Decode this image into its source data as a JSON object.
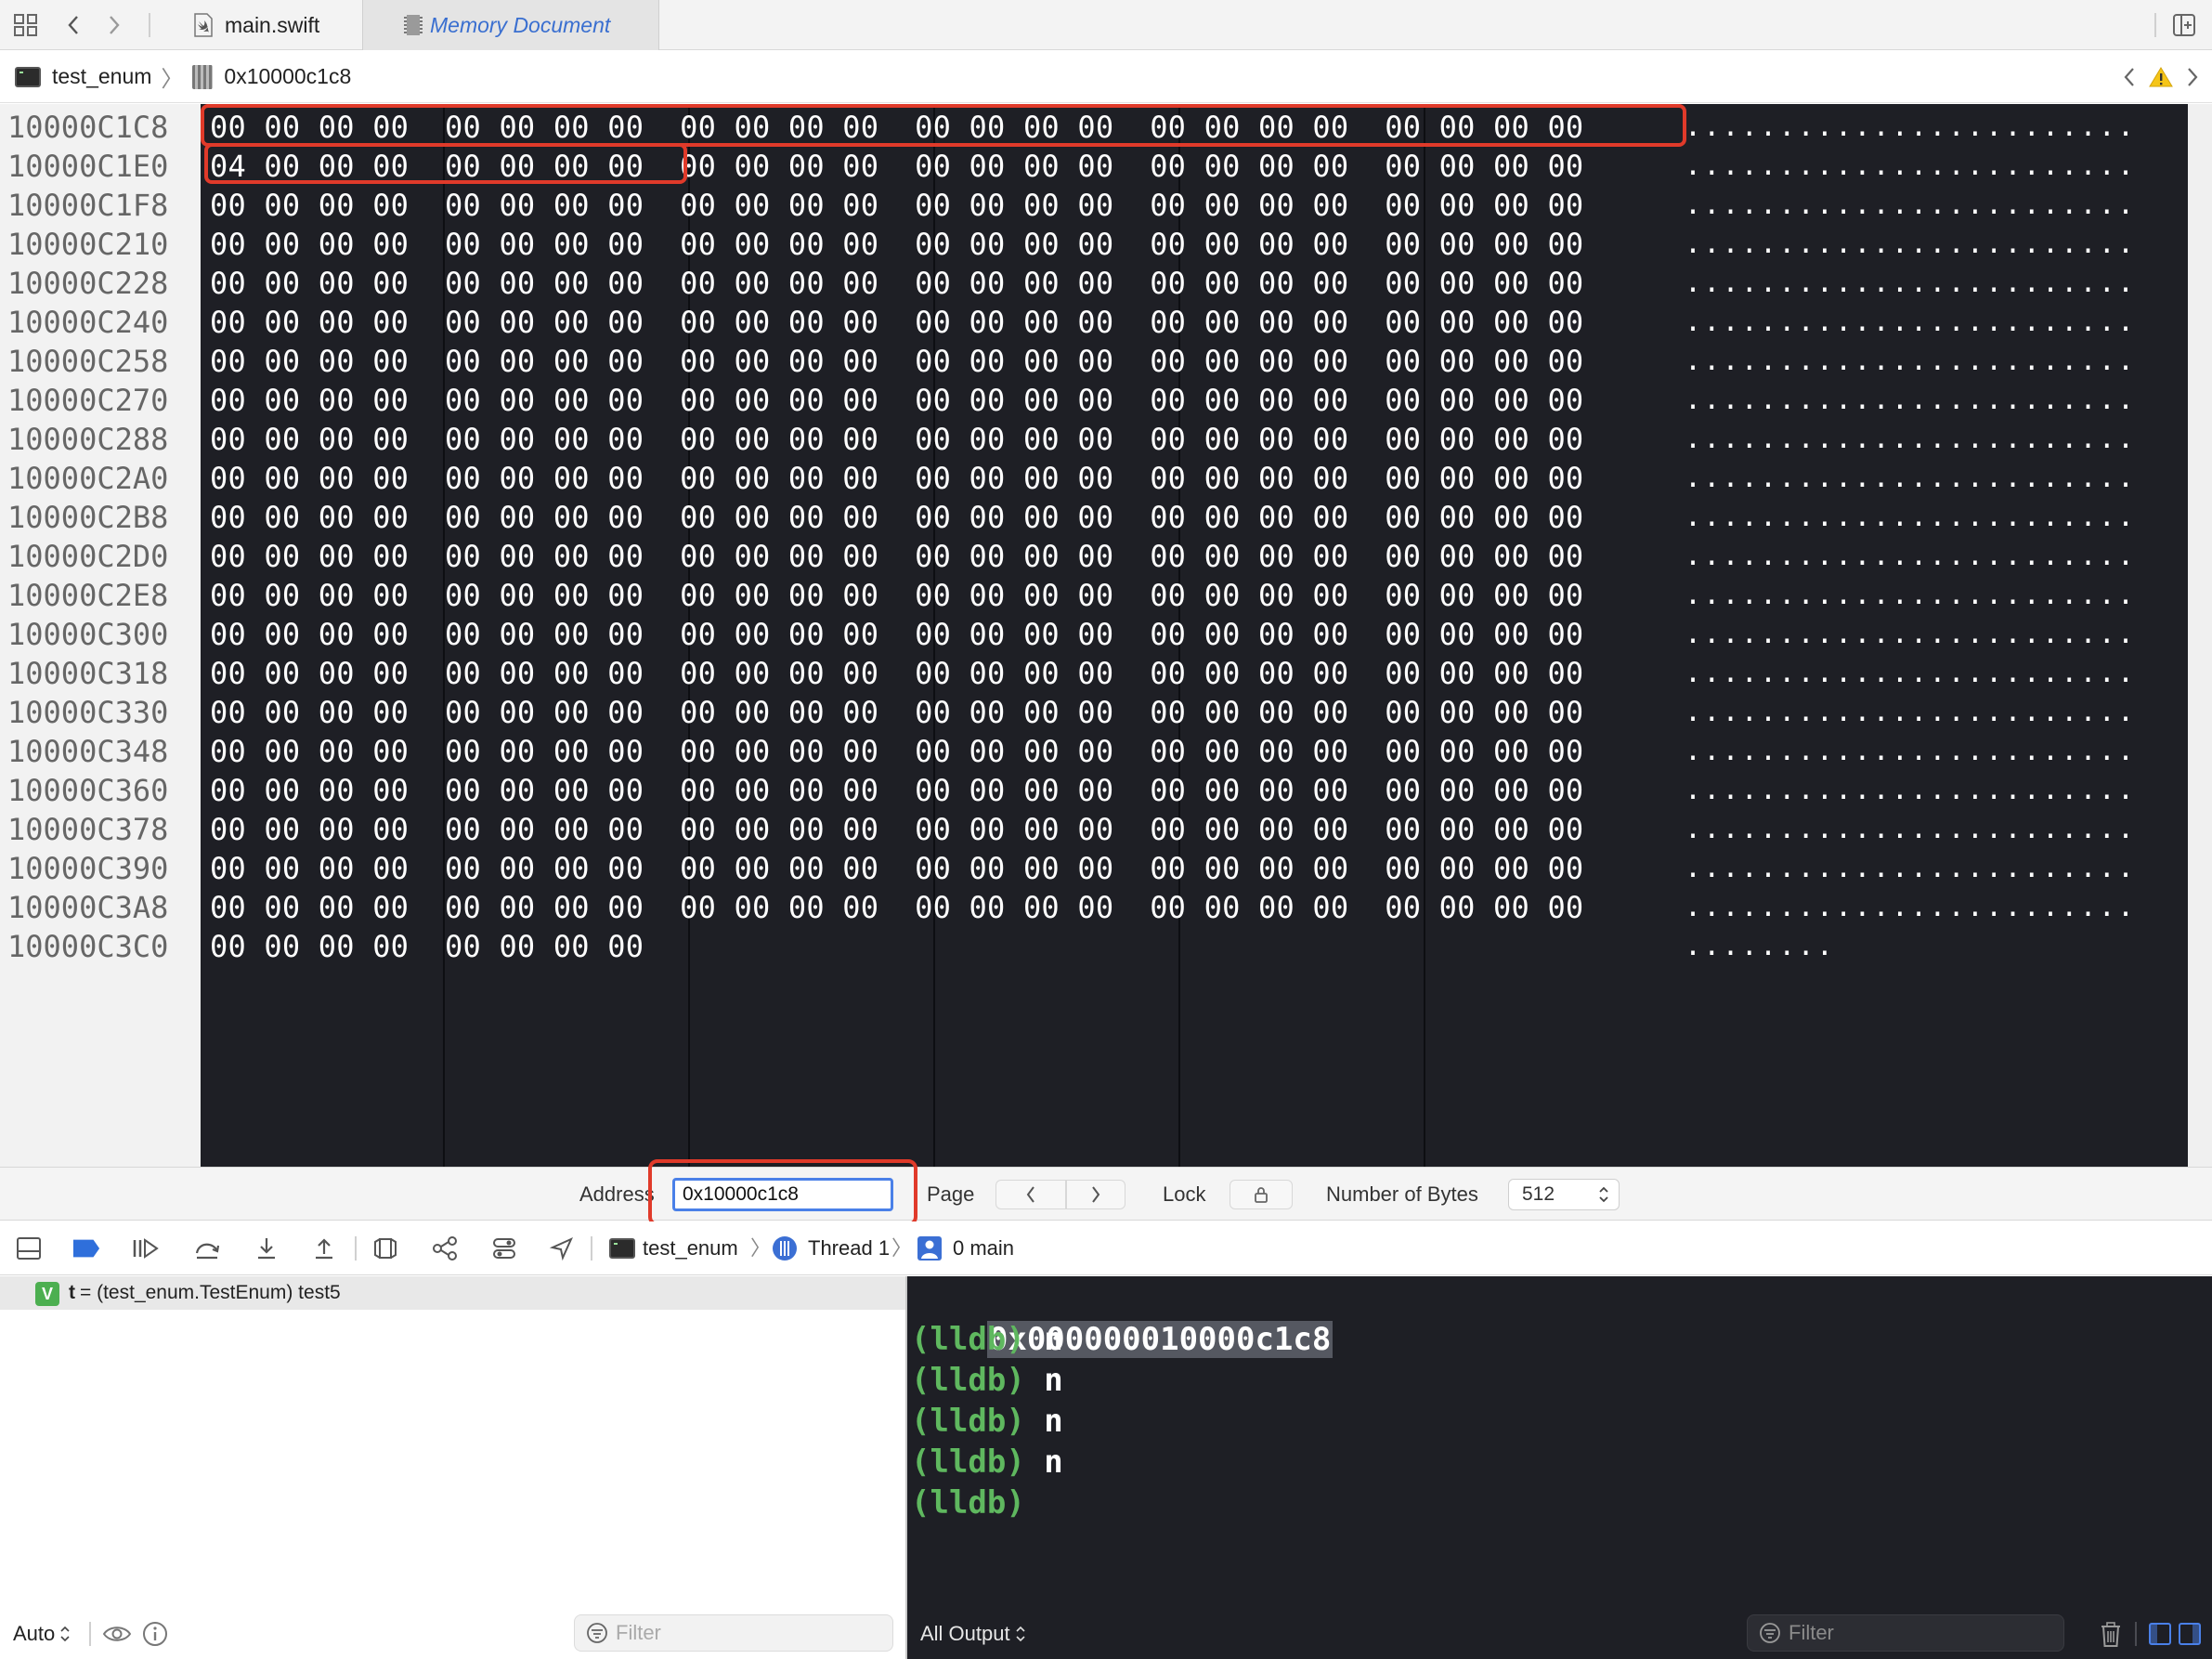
{
  "tabs": [
    {
      "label": "main.swift",
      "icon": "swift-file-icon",
      "active": false
    },
    {
      "label": "Memory Document",
      "icon": "memory-chip-icon",
      "active": true
    }
  ],
  "jumpbar": {
    "target": "test_enum",
    "address": "0x10000c1c8"
  },
  "memory": {
    "rows": [
      {
        "addr": "10000C1C8",
        "hex": "00 00 00 00  00 00 00 00  00 00 00 00  00 00 00 00  00 00 00 00  00 00 00 00",
        "ascii": "........................"
      },
      {
        "addr": "10000C1E0",
        "hex": "04 00 00 00  00 00 00 00  00 00 00 00  00 00 00 00  00 00 00 00  00 00 00 00",
        "ascii": "........................"
      },
      {
        "addr": "10000C1F8",
        "hex": "00 00 00 00  00 00 00 00  00 00 00 00  00 00 00 00  00 00 00 00  00 00 00 00",
        "ascii": "........................"
      },
      {
        "addr": "10000C210",
        "hex": "00 00 00 00  00 00 00 00  00 00 00 00  00 00 00 00  00 00 00 00  00 00 00 00",
        "ascii": "........................"
      },
      {
        "addr": "10000C228",
        "hex": "00 00 00 00  00 00 00 00  00 00 00 00  00 00 00 00  00 00 00 00  00 00 00 00",
        "ascii": "........................"
      },
      {
        "addr": "10000C240",
        "hex": "00 00 00 00  00 00 00 00  00 00 00 00  00 00 00 00  00 00 00 00  00 00 00 00",
        "ascii": "........................"
      },
      {
        "addr": "10000C258",
        "hex": "00 00 00 00  00 00 00 00  00 00 00 00  00 00 00 00  00 00 00 00  00 00 00 00",
        "ascii": "........................"
      },
      {
        "addr": "10000C270",
        "hex": "00 00 00 00  00 00 00 00  00 00 00 00  00 00 00 00  00 00 00 00  00 00 00 00",
        "ascii": "........................"
      },
      {
        "addr": "10000C288",
        "hex": "00 00 00 00  00 00 00 00  00 00 00 00  00 00 00 00  00 00 00 00  00 00 00 00",
        "ascii": "........................"
      },
      {
        "addr": "10000C2A0",
        "hex": "00 00 00 00  00 00 00 00  00 00 00 00  00 00 00 00  00 00 00 00  00 00 00 00",
        "ascii": "........................"
      },
      {
        "addr": "10000C2B8",
        "hex": "00 00 00 00  00 00 00 00  00 00 00 00  00 00 00 00  00 00 00 00  00 00 00 00",
        "ascii": "........................"
      },
      {
        "addr": "10000C2D0",
        "hex": "00 00 00 00  00 00 00 00  00 00 00 00  00 00 00 00  00 00 00 00  00 00 00 00",
        "ascii": "........................"
      },
      {
        "addr": "10000C2E8",
        "hex": "00 00 00 00  00 00 00 00  00 00 00 00  00 00 00 00  00 00 00 00  00 00 00 00",
        "ascii": "........................"
      },
      {
        "addr": "10000C300",
        "hex": "00 00 00 00  00 00 00 00  00 00 00 00  00 00 00 00  00 00 00 00  00 00 00 00",
        "ascii": "........................"
      },
      {
        "addr": "10000C318",
        "hex": "00 00 00 00  00 00 00 00  00 00 00 00  00 00 00 00  00 00 00 00  00 00 00 00",
        "ascii": "........................"
      },
      {
        "addr": "10000C330",
        "hex": "00 00 00 00  00 00 00 00  00 00 00 00  00 00 00 00  00 00 00 00  00 00 00 00",
        "ascii": "........................"
      },
      {
        "addr": "10000C348",
        "hex": "00 00 00 00  00 00 00 00  00 00 00 00  00 00 00 00  00 00 00 00  00 00 00 00",
        "ascii": "........................"
      },
      {
        "addr": "10000C360",
        "hex": "00 00 00 00  00 00 00 00  00 00 00 00  00 00 00 00  00 00 00 00  00 00 00 00",
        "ascii": "........................"
      },
      {
        "addr": "10000C378",
        "hex": "00 00 00 00  00 00 00 00  00 00 00 00  00 00 00 00  00 00 00 00  00 00 00 00",
        "ascii": "........................"
      },
      {
        "addr": "10000C390",
        "hex": "00 00 00 00  00 00 00 00  00 00 00 00  00 00 00 00  00 00 00 00  00 00 00 00",
        "ascii": "........................"
      },
      {
        "addr": "10000C3A8",
        "hex": "00 00 00 00  00 00 00 00  00 00 00 00  00 00 00 00  00 00 00 00  00 00 00 00",
        "ascii": "........................"
      },
      {
        "addr": "10000C3C0",
        "hex": "00 00 00 00  00 00 00 00",
        "ascii": "........"
      }
    ]
  },
  "addressbar": {
    "address_label": "Address",
    "address_value": "0x10000c1c8",
    "page_label": "Page",
    "lock_label": "Lock",
    "bytes_label": "Number of Bytes",
    "bytes_value": "512"
  },
  "debugbar": {
    "process": "test_enum",
    "thread": "Thread 1",
    "frame": "0 main"
  },
  "variables": {
    "badge": "V",
    "name": "t",
    "value": " = (test_enum.TestEnum) test5",
    "scope": "Auto",
    "filter_placeholder": "Filter"
  },
  "console": {
    "address_line": "0x000000010000c1c8",
    "lines": [
      {
        "prompt": "(lldb)",
        "cmd": " n"
      },
      {
        "prompt": "(lldb)",
        "cmd": " n"
      },
      {
        "prompt": "(lldb)",
        "cmd": " n"
      },
      {
        "prompt": "(lldb)",
        "cmd": " n"
      },
      {
        "prompt": "(lldb)",
        "cmd": ""
      }
    ],
    "output_mode": "All Output",
    "filter_placeholder": "Filter"
  },
  "colors": {
    "accent": "#4a80e8",
    "highlight": "#e03a2a",
    "prompt": "#5fb85f",
    "memory_bg": "#1e1f25"
  }
}
